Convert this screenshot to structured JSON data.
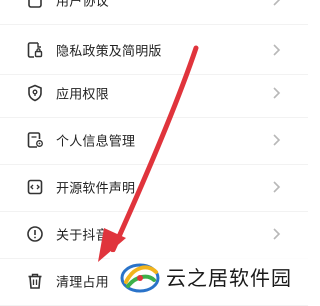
{
  "menu": {
    "items": [
      {
        "label": "用户协议",
        "icon": "document-icon"
      },
      {
        "label": "隐私政策及简明版",
        "icon": "lock-document-icon"
      },
      {
        "label": "应用权限",
        "icon": "shield-icon"
      },
      {
        "label": "个人信息管理",
        "icon": "profile-document-icon"
      },
      {
        "label": "开源软件声明",
        "icon": "code-icon"
      },
      {
        "label": "关于抖音",
        "icon": "info-icon"
      },
      {
        "label": "清理占用",
        "icon": "trash-icon"
      }
    ]
  },
  "watermark": {
    "text": "云之居软件园"
  },
  "colors": {
    "arrow": "#e0343c",
    "chevron": "#b8b8b8",
    "icon": "#333333"
  }
}
